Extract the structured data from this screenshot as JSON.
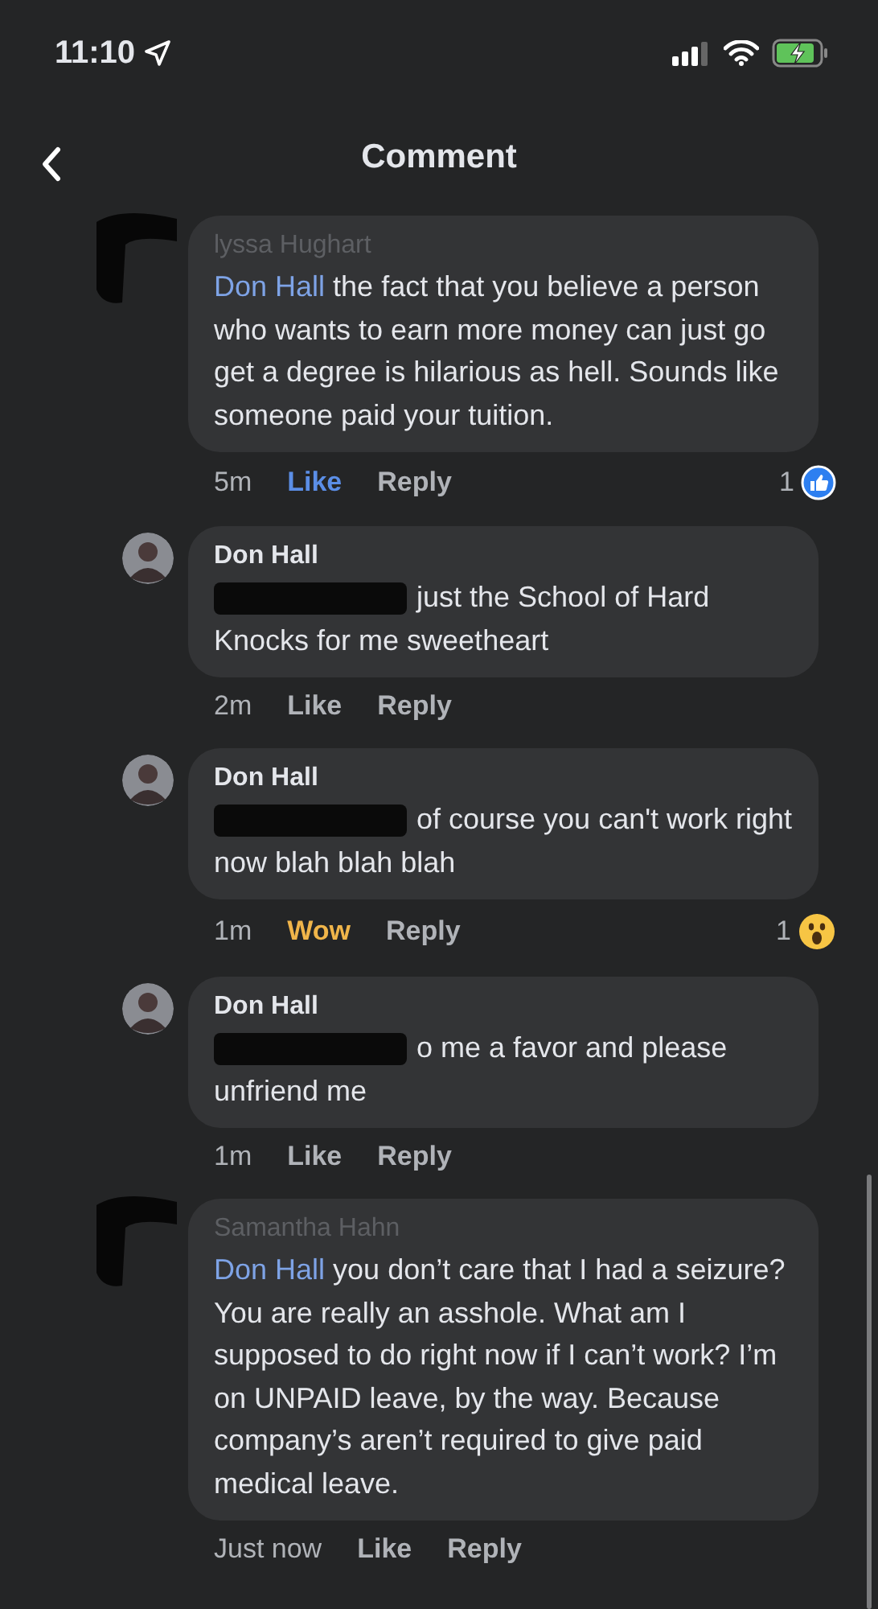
{
  "status_bar": {
    "time": "11:10"
  },
  "header": {
    "title": "Comment"
  },
  "comments": [
    {
      "kind": "top",
      "author": "lyssa Hughart",
      "author_faded": true,
      "mention": "Don Hall",
      "text": "the fact that you believe a person who wants to earn  more money can just go get a degree is hilarious as hell. Sounds like someone paid your tuition.",
      "redacted_start": false,
      "time": "5m",
      "reaction": {
        "kind": "like",
        "label": "Like"
      },
      "count": {
        "kind": "like",
        "text": "1"
      },
      "reply_label": "Reply"
    },
    {
      "kind": "reply",
      "author": "Don Hall",
      "author_faded": false,
      "text": "just the School of Hard Knocks for me sweetheart",
      "redacted_start": true,
      "time": "2m",
      "reaction": {
        "kind": "none",
        "label": "Like"
      },
      "reply_label": "Reply"
    },
    {
      "kind": "reply",
      "author": "Don Hall",
      "author_faded": false,
      "text": "of course you can't work right now blah blah blah",
      "redacted_start": true,
      "time": "1m",
      "reaction": {
        "kind": "wow",
        "label": "Wow"
      },
      "count": {
        "kind": "wow",
        "text": "1"
      },
      "reply_label": "Reply"
    },
    {
      "kind": "reply",
      "author": "Don Hall",
      "author_faded": false,
      "text": "o me a favor and please unfriend me",
      "redacted_start": true,
      "time": "1m",
      "reaction": {
        "kind": "none",
        "label": "Like"
      },
      "reply_label": "Reply"
    },
    {
      "kind": "top",
      "author": "Samantha Hahn",
      "author_faded": true,
      "mention": "Don Hall",
      "text": "you don’t care that I had a seizure? You are really an asshole. What am I supposed to do right now if I can’t work? I’m on UNPAID leave, by the way. Because company’s aren’t required to give paid medical leave.",
      "redacted_start": false,
      "time": "Just now",
      "reaction": {
        "kind": "none",
        "label": "Like"
      },
      "reply_label": "Reply"
    }
  ]
}
